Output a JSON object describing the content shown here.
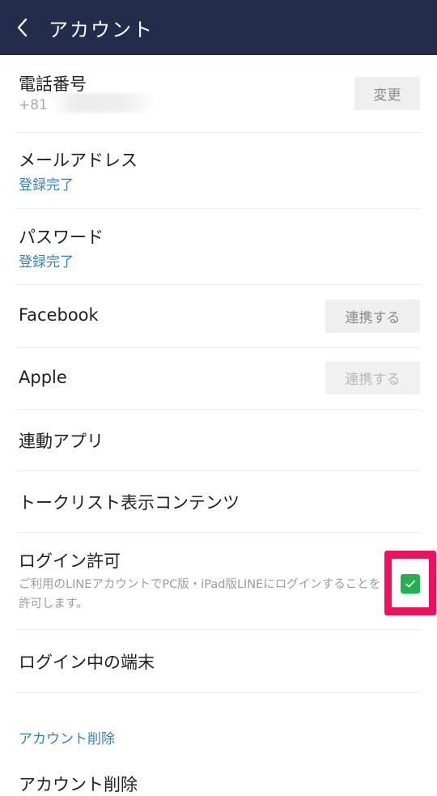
{
  "header": {
    "title": "アカウント"
  },
  "phone": {
    "label": "電話番号",
    "value": "+81",
    "button": "変更"
  },
  "email": {
    "label": "メールアドレス",
    "status": "登録完了"
  },
  "password": {
    "label": "パスワード",
    "status": "登録完了"
  },
  "facebook": {
    "label": "Facebook",
    "button": "連携する"
  },
  "apple": {
    "label": "Apple",
    "button": "連携する"
  },
  "linked_apps": {
    "label": "連動アプリ"
  },
  "talk_list": {
    "label": "トークリスト表示コンテンツ"
  },
  "login_permission": {
    "label": "ログイン許可",
    "description": "ご利用のLINEアカウントでPC版・iPad版LINEにログインすることを許可します。",
    "checked": true
  },
  "logged_in_devices": {
    "label": "ログイン中の端末"
  },
  "delete_section": {
    "header": "アカウント削除",
    "item_label": "アカウント削除"
  },
  "colors": {
    "header_bg": "#232d4b",
    "link_blue": "#3a80b5",
    "check_green": "#22b14c",
    "highlight": "#f50d5e"
  }
}
